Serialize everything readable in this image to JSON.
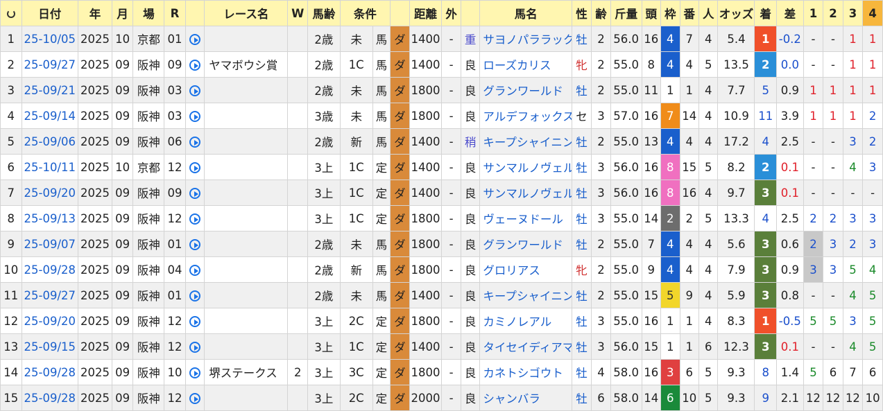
{
  "header": {
    "refresh_icon": "refresh-icon",
    "date": "日付",
    "year": "年",
    "month": "月",
    "place": "場",
    "r": "R",
    "race": "レース名",
    "w": "W",
    "age": "馬齢",
    "cond": "条件",
    "dist": "距離",
    "outer": "外",
    "horse": "馬名",
    "sex": "性",
    "age2": "齢",
    "weight": "斤量",
    "heads": "頭",
    "waku": "枠",
    "num": "番",
    "pop": "人",
    "odds": "オッズ",
    "rank": "着",
    "diff": "差",
    "c1": "1",
    "c2": "2",
    "c3": "3",
    "c4": "4"
  },
  "rows": [
    {
      "no": "1",
      "date": "25-10/05",
      "year": "2025",
      "month": "10",
      "place": "京都",
      "r": "01",
      "race": "",
      "w": "",
      "age": "2歳",
      "cls": "未",
      "cond": "馬",
      "surf": "ダ",
      "dist": "1400",
      "outer": "-",
      "baba": "重",
      "horse": "サヨノパララックス",
      "sex": "牡",
      "age2": "2",
      "weight": "56.0",
      "heads": "16",
      "waku": "4",
      "waku_color": "blue",
      "num": "7",
      "pop": "4",
      "odds": "5.4",
      "rank": "1",
      "diff": "-0.2",
      "diff_color": "blue",
      "c1": "-",
      "c2": "-",
      "c3": "1",
      "c4": "1",
      "c3c": "red",
      "c4c": "red",
      "c1c": "dark",
      "c2c": "dark"
    },
    {
      "no": "2",
      "date": "25-09/27",
      "year": "2025",
      "month": "09",
      "place": "阪神",
      "r": "09",
      "race": "ヤマボウシ賞",
      "w": "",
      "age": "2歳",
      "cls": "1C",
      "cond": "馬",
      "surf": "ダ",
      "dist": "1400",
      "outer": "-",
      "baba": "良",
      "horse": "ローズカリス",
      "sex": "牝",
      "age2": "2",
      "weight": "55.0",
      "heads": "8",
      "waku": "4",
      "waku_color": "blue",
      "num": "4",
      "pop": "5",
      "odds": "13.5",
      "rank": "2",
      "diff": "0.0",
      "diff_color": "blue",
      "c1": "-",
      "c2": "-",
      "c3": "1",
      "c4": "1",
      "c3c": "red",
      "c4c": "red",
      "c1c": "dark",
      "c2c": "dark"
    },
    {
      "no": "3",
      "date": "25-09/21",
      "year": "2025",
      "month": "09",
      "place": "阪神",
      "r": "03",
      "race": "",
      "w": "",
      "age": "2歳",
      "cls": "未",
      "cond": "馬",
      "surf": "ダ",
      "dist": "1800",
      "outer": "-",
      "baba": "良",
      "horse": "グランワールド",
      "sex": "牡",
      "age2": "2",
      "weight": "55.0",
      "heads": "11",
      "waku": "1",
      "waku_color": "white",
      "num": "1",
      "pop": "4",
      "odds": "7.7",
      "rank": "5",
      "diff": "0.9",
      "diff_color": "dark",
      "c1": "1",
      "c2": "1",
      "c3": "1",
      "c4": "1",
      "c1c": "red",
      "c2c": "red",
      "c3c": "red",
      "c4c": "red"
    },
    {
      "no": "4",
      "date": "25-09/14",
      "year": "2025",
      "month": "09",
      "place": "阪神",
      "r": "03",
      "race": "",
      "w": "",
      "age": "3歳",
      "cls": "未",
      "cond": "馬",
      "surf": "ダ",
      "dist": "1800",
      "outer": "-",
      "baba": "良",
      "horse": "アルデフォックス",
      "sex": "セ",
      "age2": "3",
      "weight": "57.0",
      "heads": "16",
      "waku": "7",
      "waku_color": "orange",
      "num": "14",
      "pop": "4",
      "odds": "10.9",
      "rank": "11",
      "diff": "3.9",
      "diff_color": "dark",
      "c1": "1",
      "c2": "1",
      "c3": "1",
      "c4": "2",
      "c1c": "red",
      "c2c": "red",
      "c3c": "red",
      "c4c": "blue"
    },
    {
      "no": "5",
      "date": "25-09/06",
      "year": "2025",
      "month": "09",
      "place": "阪神",
      "r": "06",
      "race": "",
      "w": "",
      "age": "2歳",
      "cls": "新",
      "cond": "馬",
      "surf": "ダ",
      "dist": "1400",
      "outer": "-",
      "baba": "稍",
      "horse": "キープシャイニング",
      "sex": "牡",
      "age2": "2",
      "weight": "55.0",
      "heads": "13",
      "waku": "4",
      "waku_color": "blue",
      "num": "4",
      "pop": "4",
      "odds": "17.2",
      "rank": "4",
      "diff": "2.5",
      "diff_color": "dark",
      "c1": "-",
      "c2": "-",
      "c3": "3",
      "c4": "2",
      "c1c": "dark",
      "c2c": "dark",
      "c3c": "blue",
      "c4c": "blue"
    },
    {
      "no": "6",
      "date": "25-10/11",
      "year": "2025",
      "month": "10",
      "place": "京都",
      "r": "12",
      "race": "",
      "w": "",
      "age": "3上",
      "cls": "1C",
      "cond": "定",
      "surf": "ダ",
      "dist": "1400",
      "outer": "-",
      "baba": "良",
      "horse": "サンマルノヴェル",
      "sex": "牡",
      "age2": "3",
      "weight": "56.0",
      "heads": "16",
      "waku": "8",
      "waku_color": "pink",
      "num": "15",
      "pop": "5",
      "odds": "8.2",
      "rank": "2",
      "diff": "0.1",
      "diff_color": "red",
      "c1": "-",
      "c2": "-",
      "c3": "4",
      "c4": "3",
      "c1c": "dark",
      "c2c": "dark",
      "c3c": "green",
      "c4c": "blue"
    },
    {
      "no": "7",
      "date": "25-09/20",
      "year": "2025",
      "month": "09",
      "place": "阪神",
      "r": "09",
      "race": "",
      "w": "",
      "age": "3上",
      "cls": "1C",
      "cond": "定",
      "surf": "ダ",
      "dist": "1400",
      "outer": "-",
      "baba": "良",
      "horse": "サンマルノヴェル",
      "sex": "牡",
      "age2": "3",
      "weight": "56.0",
      "heads": "16",
      "waku": "8",
      "waku_color": "pink",
      "num": "16",
      "pop": "4",
      "odds": "9.7",
      "rank": "3",
      "diff": "0.1",
      "diff_color": "red",
      "c1": "-",
      "c2": "-",
      "c3": "-",
      "c4": "-",
      "c1c": "dark",
      "c2c": "dark",
      "c3c": "dark",
      "c4c": "dark"
    },
    {
      "no": "8",
      "date": "25-09/13",
      "year": "2025",
      "month": "09",
      "place": "阪神",
      "r": "12",
      "race": "",
      "w": "",
      "age": "3上",
      "cls": "1C",
      "cond": "定",
      "surf": "ダ",
      "dist": "1800",
      "outer": "-",
      "baba": "良",
      "horse": "ヴェーヌドール",
      "sex": "牡",
      "age2": "3",
      "weight": "55.0",
      "heads": "14",
      "waku": "2",
      "waku_color": "gray",
      "num": "2",
      "pop": "5",
      "odds": "13.3",
      "rank": "4",
      "diff": "2.5",
      "diff_color": "dark",
      "c1": "2",
      "c2": "2",
      "c3": "3",
      "c4": "3",
      "c1c": "blue",
      "c2c": "blue",
      "c3c": "blue",
      "c4c": "blue"
    },
    {
      "no": "9",
      "date": "25-09/07",
      "year": "2025",
      "month": "09",
      "place": "阪神",
      "r": "01",
      "race": "",
      "w": "",
      "age": "2歳",
      "cls": "未",
      "cond": "馬",
      "surf": "ダ",
      "dist": "1800",
      "outer": "-",
      "baba": "良",
      "horse": "グランワールド",
      "sex": "牡",
      "age2": "2",
      "weight": "55.0",
      "heads": "7",
      "waku": "4",
      "waku_color": "blue",
      "num": "4",
      "pop": "4",
      "odds": "5.6",
      "rank": "3",
      "diff": "0.6",
      "diff_color": "dark",
      "c1": "2",
      "c2": "3",
      "c3": "2",
      "c4": "3",
      "c1c": "blue",
      "c2c": "blue",
      "c3c": "blue",
      "c4c": "blue",
      "c1hl": true
    },
    {
      "no": "10",
      "date": "25-09/28",
      "year": "2025",
      "month": "09",
      "place": "阪神",
      "r": "04",
      "race": "",
      "w": "",
      "age": "2歳",
      "cls": "新",
      "cond": "馬",
      "surf": "ダ",
      "dist": "1800",
      "outer": "-",
      "baba": "良",
      "horse": "グロリアス",
      "sex": "牝",
      "age2": "2",
      "weight": "55.0",
      "heads": "9",
      "waku": "4",
      "waku_color": "blue",
      "num": "4",
      "pop": "4",
      "odds": "7.9",
      "rank": "3",
      "diff": "0.9",
      "diff_color": "dark",
      "c1": "3",
      "c2": "3",
      "c3": "5",
      "c4": "4",
      "c1c": "blue",
      "c2c": "blue",
      "c3c": "green",
      "c4c": "green",
      "c1hl": true
    },
    {
      "no": "11",
      "date": "25-09/27",
      "year": "2025",
      "month": "09",
      "place": "阪神",
      "r": "01",
      "race": "",
      "w": "",
      "age": "2歳",
      "cls": "未",
      "cond": "馬",
      "surf": "ダ",
      "dist": "1400",
      "outer": "-",
      "baba": "良",
      "horse": "キープシャイニング",
      "sex": "牡",
      "age2": "2",
      "weight": "55.0",
      "heads": "15",
      "waku": "5",
      "waku_color": "yellow",
      "num": "9",
      "pop": "4",
      "odds": "5.9",
      "rank": "3",
      "diff": "0.8",
      "diff_color": "dark",
      "c1": "-",
      "c2": "-",
      "c3": "4",
      "c4": "5",
      "c1c": "dark",
      "c2c": "dark",
      "c3c": "green",
      "c4c": "green"
    },
    {
      "no": "12",
      "date": "25-09/20",
      "year": "2025",
      "month": "09",
      "place": "阪神",
      "r": "12",
      "race": "",
      "w": "",
      "age": "3上",
      "cls": "2C",
      "cond": "定",
      "surf": "ダ",
      "dist": "1800",
      "outer": "-",
      "baba": "良",
      "horse": "カミノレアル",
      "sex": "牡",
      "age2": "3",
      "weight": "55.0",
      "heads": "16",
      "waku": "1",
      "waku_color": "white",
      "num": "1",
      "pop": "4",
      "odds": "8.3",
      "rank": "1",
      "diff": "-0.5",
      "diff_color": "blue",
      "c1": "5",
      "c2": "5",
      "c3": "3",
      "c4": "5",
      "c1c": "green",
      "c2c": "green",
      "c3c": "blue",
      "c4c": "green"
    },
    {
      "no": "13",
      "date": "25-09/15",
      "year": "2025",
      "month": "09",
      "place": "阪神",
      "r": "12",
      "race": "",
      "w": "",
      "age": "3上",
      "cls": "1C",
      "cond": "定",
      "surf": "ダ",
      "dist": "1400",
      "outer": "-",
      "baba": "良",
      "horse": "タイセイディアマン",
      "sex": "牡",
      "age2": "3",
      "weight": "56.0",
      "heads": "15",
      "waku": "1",
      "waku_color": "white",
      "num": "1",
      "pop": "6",
      "odds": "12.3",
      "rank": "3",
      "diff": "0.1",
      "diff_color": "red",
      "c1": "-",
      "c2": "-",
      "c3": "4",
      "c4": "5",
      "c1c": "dark",
      "c2c": "dark",
      "c3c": "green",
      "c4c": "green"
    },
    {
      "no": "14",
      "date": "25-09/28",
      "year": "2025",
      "month": "09",
      "place": "阪神",
      "r": "10",
      "race": "堺ステークス",
      "w": "2",
      "age": "3上",
      "cls": "3C",
      "cond": "定",
      "surf": "ダ",
      "dist": "1800",
      "outer": "-",
      "baba": "良",
      "horse": "カネトシゴウト",
      "sex": "牡",
      "age2": "4",
      "weight": "58.0",
      "heads": "16",
      "waku": "3",
      "waku_color": "red",
      "num": "6",
      "pop": "5",
      "odds": "9.3",
      "rank": "8",
      "diff": "1.4",
      "diff_color": "dark",
      "c1": "5",
      "c2": "6",
      "c3": "7",
      "c4": "6",
      "c1c": "green",
      "c2c": "dark",
      "c3c": "dark",
      "c4c": "dark"
    },
    {
      "no": "15",
      "date": "25-09/28",
      "year": "2025",
      "month": "09",
      "place": "阪神",
      "r": "12",
      "race": "",
      "w": "",
      "age": "3上",
      "cls": "2C",
      "cond": "定",
      "surf": "ダ",
      "dist": "2000",
      "outer": "-",
      "baba": "良",
      "horse": "シャンバラ",
      "sex": "牡",
      "age2": "6",
      "weight": "58.0",
      "heads": "14",
      "waku": "6",
      "waku_color": "green",
      "num": "10",
      "pop": "5",
      "odds": "9.3",
      "rank": "9",
      "diff": "2.1",
      "diff_color": "dark",
      "c1": "12",
      "c2": "12",
      "c3": "12",
      "c4": "10",
      "c1c": "dark",
      "c2c": "dark",
      "c3c": "dark",
      "c4c": "dark"
    }
  ]
}
